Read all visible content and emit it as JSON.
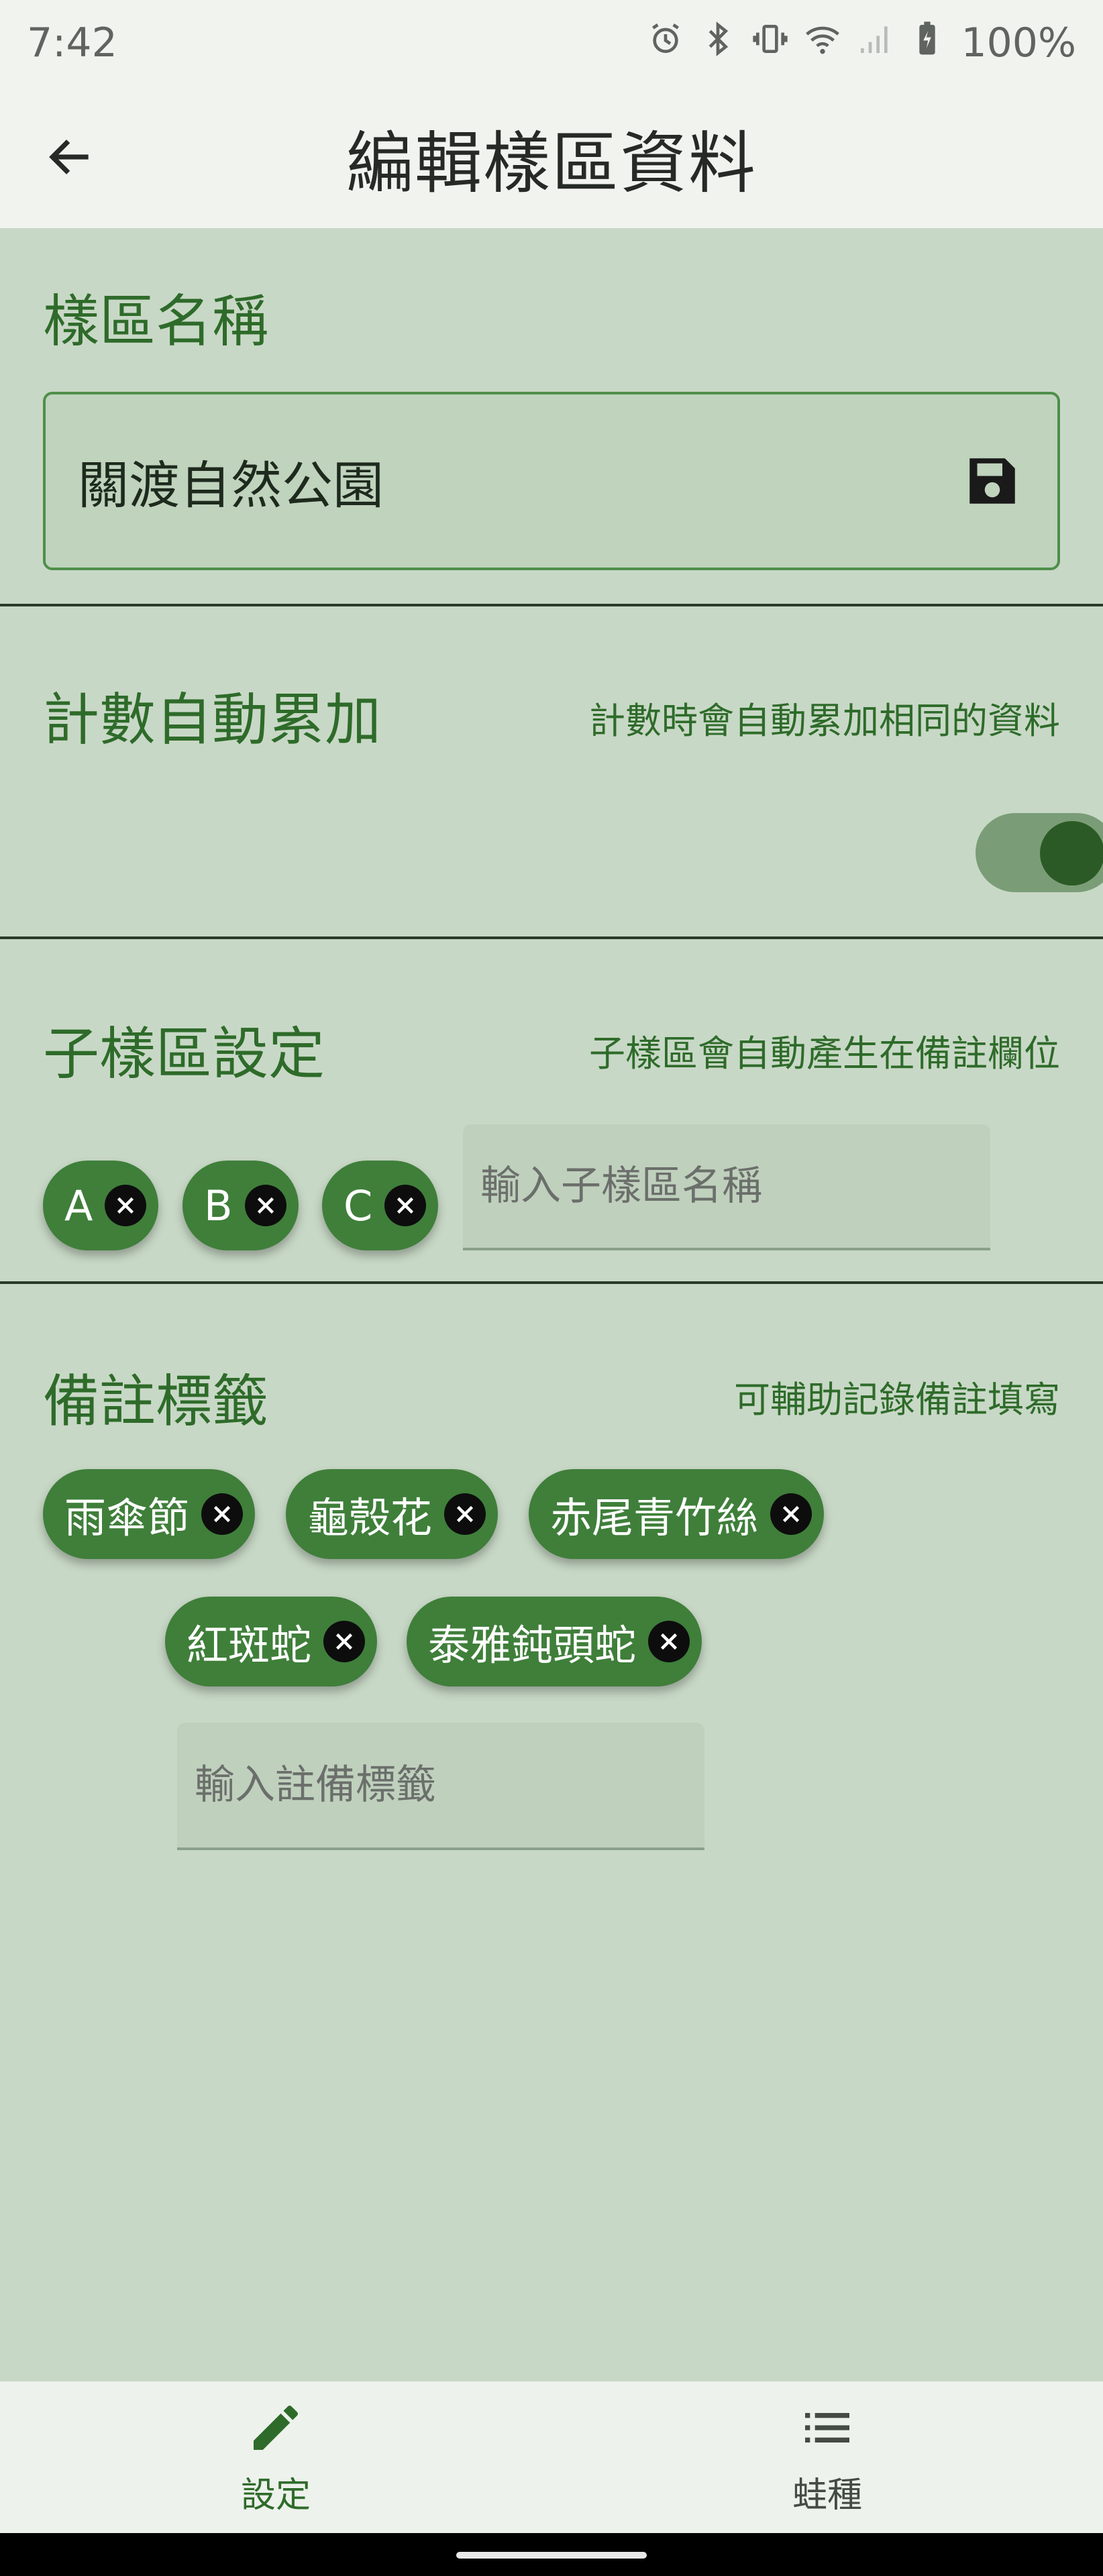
{
  "status_bar": {
    "time": "7:42",
    "battery": "100%",
    "icons": [
      "alarm-icon",
      "bluetooth-icon",
      "vibrate-icon",
      "wifi-icon",
      "cell-signal-icon",
      "battery-charging-icon"
    ]
  },
  "app_bar": {
    "title": "編輯樣區資料",
    "back_icon": "arrow-back-icon"
  },
  "section_name": {
    "title": "樣區名稱",
    "value": "關渡自然公園",
    "save_icon": "save-icon"
  },
  "section_auto": {
    "title": "計數自動累加",
    "hint": "計數時會自動累加相同的資料",
    "toggle_on": true
  },
  "section_sub": {
    "title": "子樣區設定",
    "hint": "子樣區會自動產生在備註欄位",
    "chips": [
      "A",
      "B",
      "C"
    ],
    "input_placeholder": "輸入子樣區名稱"
  },
  "section_tags": {
    "title": "備註標籤",
    "hint": "可輔助記錄備註填寫",
    "chips": [
      "雨傘節",
      "龜殼花",
      "赤尾青竹絲",
      "紅斑蛇",
      "泰雅鈍頭蛇"
    ],
    "input_placeholder": "輸入註備標籤"
  },
  "bottom_nav": {
    "items": [
      {
        "label": "設定",
        "icon": "pencil-edit-icon",
        "active": true
      },
      {
        "label": "蛙種",
        "icon": "list-icon",
        "active": false
      }
    ]
  },
  "colors": {
    "background": "#c8d8c6",
    "accent": "#2e6b2a",
    "chip": "#3f7f3a",
    "appbar": "#f0f3ee"
  }
}
